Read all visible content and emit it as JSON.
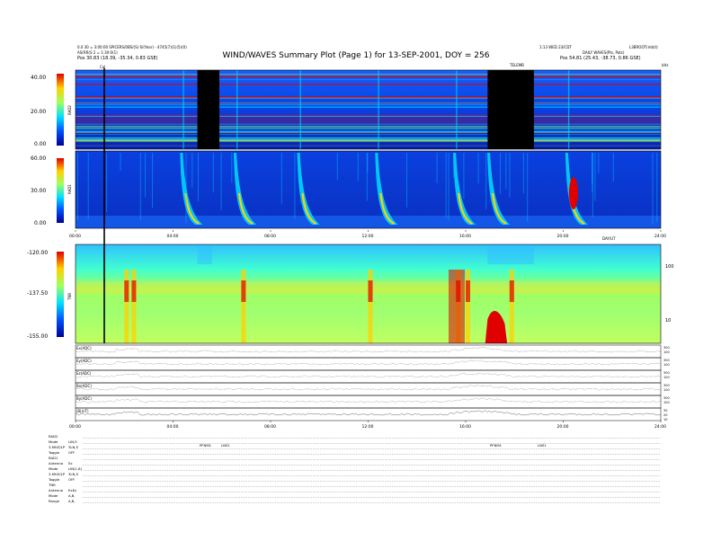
{
  "header": {
    "title": "WIND/WAVES Summary Plot (Page 1) for 13-SEP-2001, DOY = 256",
    "left_line1": "0.0 30 = 3:00:00 SPICERS/0BS/(S) 6/(Year) - 4745(7)(1)(5)(0)",
    "left_line2": "AS(RR(S 2 = 1:30:0(1)",
    "left_line3": "Pos      30.83 (18.39, -35.34, 0.83 GSE)",
    "right_line1": "1:13 WED 23/CDT",
    "right_line2": "L3BROOT(mb(t)",
    "right_line3": "DAILY   WAVES(Pts, Pats)",
    "right_line4": "Pos      54.81 (25.43, -38.73, 0.86 GSE)",
    "right_top_marker": "TELEMB",
    "marker_cal": "Cal",
    "marker_top_right": "kHz"
  },
  "chart_data": [
    {
      "type": "heatmap",
      "name": "RAD2",
      "ylabel": "RAD2",
      "colorbar_ticks": [
        "40.00",
        "20.00",
        "0.00"
      ],
      "data_gaps_hours": [
        [
          5.0,
          5.9
        ],
        [
          16.9,
          18.8
        ]
      ]
    },
    {
      "type": "heatmap",
      "name": "RAD1",
      "ylabel": "RAD1",
      "colorbar_ticks": [
        "60.00",
        "30.00",
        "0.00"
      ],
      "x_ticks": [
        "00:00",
        "04:00",
        "08:00",
        "12:00",
        "16:00",
        "20:00",
        "24:00"
      ],
      "x_unit_label": "DAY/UT",
      "type_iii_bursts_hours": [
        4.4,
        6.6,
        9.2,
        12.4,
        15.6,
        17.0,
        20.2
      ]
    },
    {
      "type": "heatmap",
      "name": "TNR",
      "ylabel": "TNR",
      "colorbar_ticks": [
        "-120.00",
        "-137.50",
        "-155.00"
      ],
      "right_axis_ticks": [
        "100",
        "10"
      ],
      "right_axis_unit": "kHz"
    },
    {
      "type": "line",
      "name": "wave_amplitude_traces",
      "rows": [
        {
          "label": "Ex(ADC)",
          "right_ticks": [
            "300",
            "100"
          ]
        },
        {
          "label": "Ey(ADC)",
          "right_ticks": [
            "300",
            "100"
          ]
        },
        {
          "label": "Ez(ADC)",
          "right_ticks": [
            "300",
            "100"
          ]
        },
        {
          "label": "Bx(ADC)",
          "right_ticks": [
            "300",
            "100"
          ]
        },
        {
          "label": "By(ADC)",
          "right_ticks": [
            "300",
            "100"
          ]
        },
        {
          "label": "|B|(nT)",
          "right_ticks": [
            "30",
            "20",
            "10"
          ]
        }
      ],
      "x_ticks": [
        "00:00",
        "04:00",
        "08:00",
        "12:00",
        "16:00",
        "20:00",
        "24:00"
      ]
    }
  ],
  "status": {
    "rows": [
      {
        "label": "RAD2",
        "value": ""
      },
      {
        "label": "Mode",
        "value": "LIN,S"
      },
      {
        "label": "3-MHZ/LP",
        "value": "3LN,S"
      },
      {
        "label": "Toggle",
        "value": "OFF"
      },
      {
        "label": "RAD1",
        "value": ""
      },
      {
        "label": "Antenna",
        "value": "Ex"
      },
      {
        "label": "Mode",
        "value": "LIN(1,8)"
      },
      {
        "label": "3-MHZ/LP",
        "value": "3LN,S"
      },
      {
        "label": "Toggle",
        "value": "OFF"
      },
      {
        "label": "TNR",
        "value": ""
      },
      {
        "label": "Antenna",
        "value": "ExEy"
      },
      {
        "label": "Mode",
        "value": "A,B,"
      },
      {
        "label": "Range",
        "value": "A,B,"
      }
    ],
    "event_labels": [
      "PFNM1",
      "LNS1",
      "PFNM1",
      "LNS1"
    ]
  }
}
